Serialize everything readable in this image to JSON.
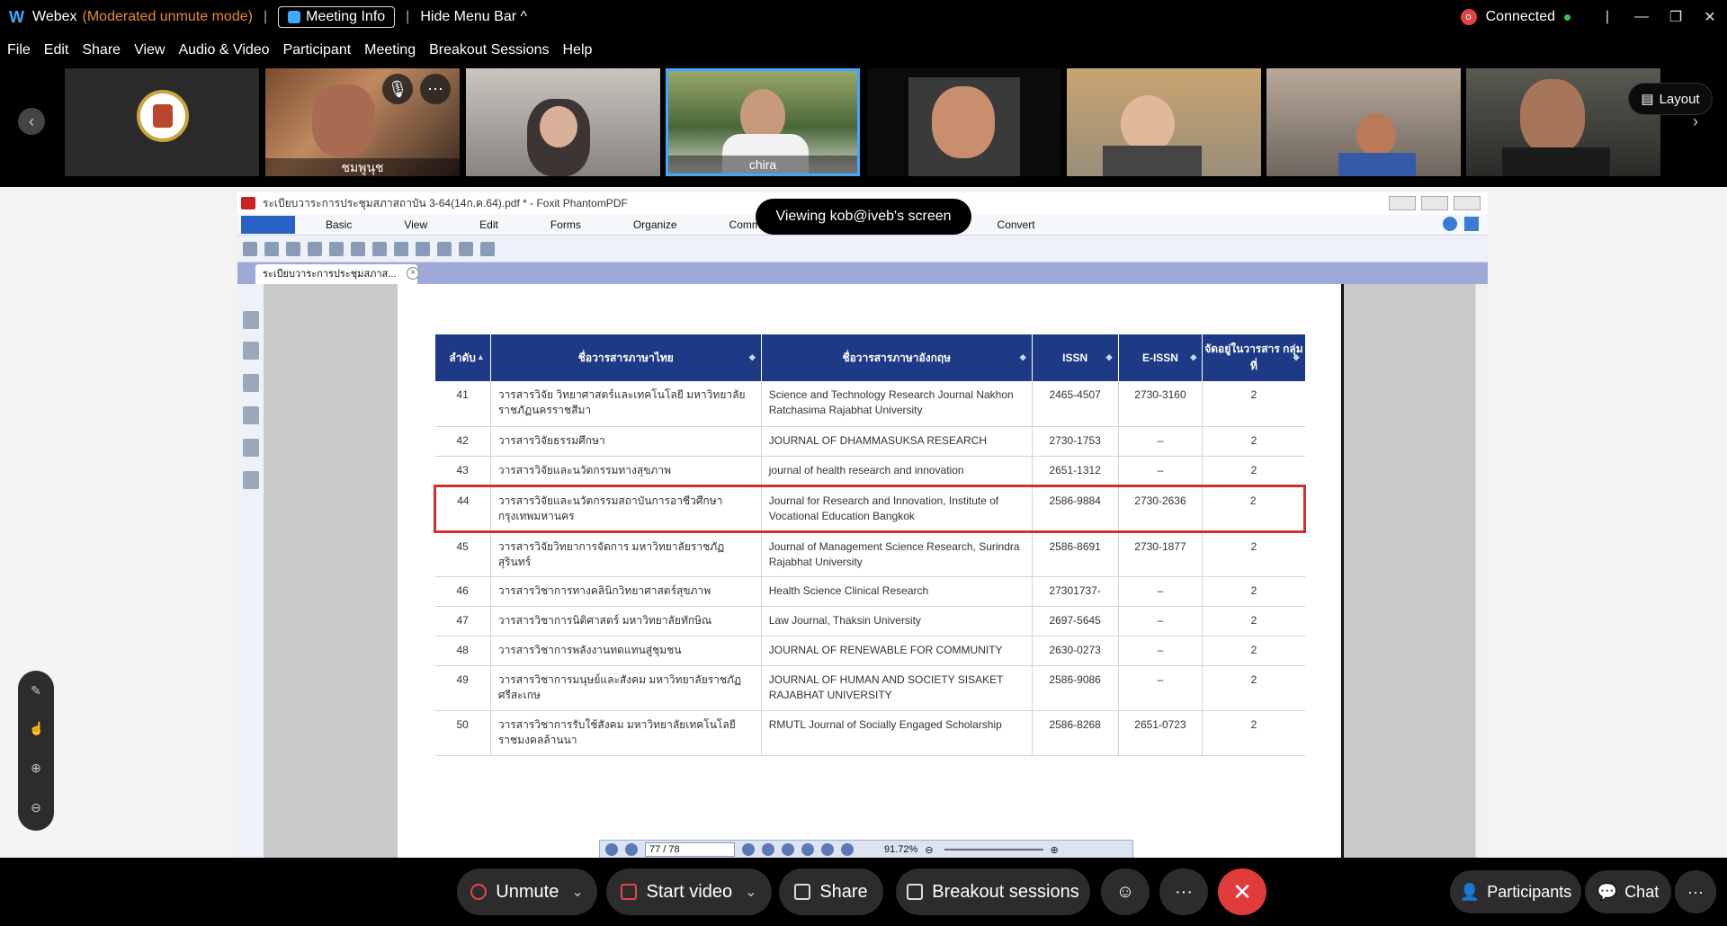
{
  "titlebar": {
    "app": "Webex",
    "mode": "(Moderated unmute mode)",
    "meeting_info": "Meeting Info",
    "hide_menu": "Hide Menu Bar ^",
    "rec_badge": "o",
    "status": "Connected",
    "status_color": "#38c15b"
  },
  "menu": [
    "File",
    "Edit",
    "Share",
    "View",
    "Audio & Video",
    "Participant",
    "Meeting",
    "Breakout Sessions",
    "Help"
  ],
  "participants": [
    {
      "name": ""
    },
    {
      "name": "ชมพูนุช"
    },
    {
      "name": ""
    },
    {
      "name": "chira"
    },
    {
      "name": ""
    },
    {
      "name": ""
    },
    {
      "name": ""
    },
    {
      "name": ""
    }
  ],
  "layout_label": "Layout",
  "toast": "Viewing kob@iveb's screen",
  "foxit": {
    "title": "ระเบียบวาระการประชุมสภาสถาบัน 3-64(14ก.ค.64).pdf * - Foxit PhantomPDF",
    "ribbon": [
      "Basic",
      "View",
      "Edit",
      "Forms",
      "Organize",
      "Comments",
      "Convert"
    ],
    "tab": "ระเบียบวาระการประชุมสภาส...",
    "page_indicator": "77 / 78",
    "zoom": "91.72%"
  },
  "table": {
    "headers": [
      "ลำดับ",
      "ชื่อวารสารภาษาไทย",
      "ชื่อวารสารภาษาอังกฤษ",
      "ISSN",
      "E-ISSN",
      "จัดอยู่ในวารสาร กลุ่มที่"
    ],
    "rows": [
      {
        "no": "41",
        "th": "วารสารวิจัย วิทยาศาสตร์และเทคโนโลยี มหาวิทยาลัยราชภัฏนครราชสีมา",
        "en": "Science and Technology Research Journal Nakhon Ratchasima Rajabhat University",
        "issn": "2465-4507",
        "eissn": "2730-3160",
        "group": "2"
      },
      {
        "no": "42",
        "th": "วารสารวิจัยธรรมศึกษา",
        "en": "JOURNAL OF DHAMMASUKSA RESEARCH",
        "issn": "2730-1753",
        "eissn": "–",
        "group": "2"
      },
      {
        "no": "43",
        "th": "วารสารวิจัยและนวัตกรรมทางสุขภาพ",
        "en": "journal of health research and innovation",
        "issn": "2651-1312",
        "eissn": "–",
        "group": "2"
      },
      {
        "no": "44",
        "th": "วารสารวิจัยและนวัตกรรมสถาบันการอาชีวศึกษากรุงเทพมหานคร",
        "en": "Journal for Research and Innovation, Institute of Vocational Education Bangkok",
        "issn": "2586-9884",
        "eissn": "2730-2636",
        "group": "2"
      },
      {
        "no": "45",
        "th": "วารสารวิจัยวิทยาการจัดการ มหาวิทยาลัยราชภัฏสุรินทร์",
        "en": "Journal of Management Science Research, Surindra Rajabhat University",
        "issn": "2586-8691",
        "eissn": "2730-1877",
        "group": "2"
      },
      {
        "no": "46",
        "th": "วารสารวิชาการทางคลินิกวิทยาศาสตร์สุขภาพ",
        "en": "Health Science Clinical Research",
        "issn": "27301737-",
        "eissn": "–",
        "group": "2"
      },
      {
        "no": "47",
        "th": "วารสารวิชาการนิติศาสตร์ มหาวิทยาลัยทักษิณ",
        "en": "Law Journal, Thaksin University",
        "issn": "2697-5645",
        "eissn": "–",
        "group": "2"
      },
      {
        "no": "48",
        "th": "วารสารวิชาการพลังงานทดแทนสู่ชุมชน",
        "en": "JOURNAL OF RENEWABLE FOR COMMUNITY",
        "issn": "2630-0273",
        "eissn": "–",
        "group": "2"
      },
      {
        "no": "49",
        "th": "วารสารวิชาการมนุษย์และสังคม มหาวิทยาลัยราชภัฏศรีสะเกษ",
        "en": "JOURNAL OF HUMAN AND SOCIETY SISAKET RAJABHAT UNIVERSITY",
        "issn": "2586-9086",
        "eissn": "–",
        "group": "2"
      },
      {
        "no": "50",
        "th": "วารสารวิชาการรับใช้สังคม มหาวิทยาลัยเทคโนโลยีราชมงคลล้านนา",
        "en": "RMUTL Journal of Socially Engaged Scholarship",
        "issn": "2586-8268",
        "eissn": "2651-0723",
        "group": "2"
      }
    ]
  },
  "controls": {
    "unmute": "Unmute",
    "start_video": "Start video",
    "share": "Share",
    "breakout": "Breakout sessions",
    "participants": "Participants",
    "chat": "Chat",
    "more": "···",
    "end_color": "#e13c3c"
  }
}
